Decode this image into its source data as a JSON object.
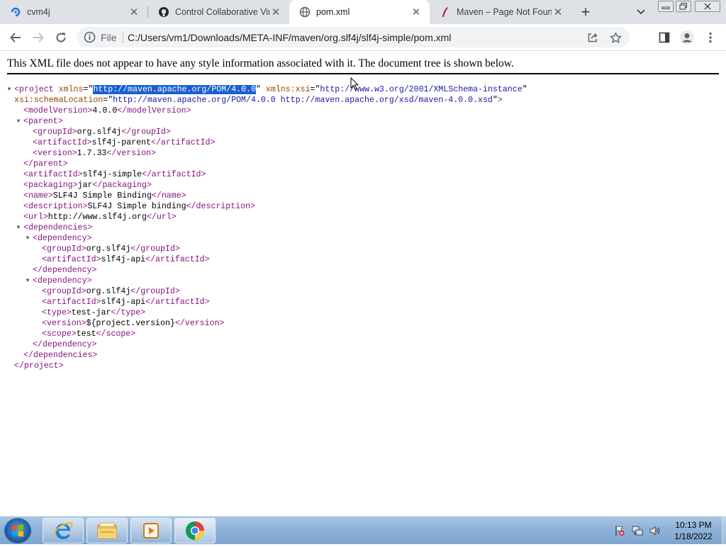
{
  "browser": {
    "tabs": [
      {
        "title": "cvm4j",
        "icon": "cvm4j-favicon-icon",
        "active": false
      },
      {
        "title": "Control Collaborative Vir",
        "icon": "github-favicon-icon",
        "active": false
      },
      {
        "title": "pom.xml",
        "icon": "globe-favicon-icon",
        "active": true
      },
      {
        "title": "Maven – Page Not Found",
        "icon": "maven-feather-icon",
        "active": false
      }
    ],
    "scheme_label": "File",
    "url": "C:/Users/vm1/Downloads/META-INF/maven/org.slf4j/slf4j-simple/pom.xml"
  },
  "page": {
    "notice": "This XML file does not appear to have any style information associated with it. The document tree is shown below.",
    "xml": {
      "root_tag": "project",
      "xmlns_attr": "xmlns",
      "xmlns_value": "http://maven.apache.org/POM/4.0.0",
      "xsi_attr": "xmlns:xsi",
      "xsi_value": "http://www.w3.org/2001/XMLSchema-instance",
      "schema_attr": "xsi:schemaLocation",
      "schema_value": "http://maven.apache.org/POM/4.0.0 http://maven.apache.org/xsd/maven-4.0.0.xsd",
      "modelVersion": "4.0.0",
      "parent": {
        "groupId": "org.slf4j",
        "artifactId": "slf4j-parent",
        "version": "1.7.33"
      },
      "artifactId": "slf4j-simple",
      "packaging": "jar",
      "name": "SLF4J Simple Binding",
      "description": "SLF4J Simple binding",
      "url": "http://www.slf4j.org",
      "dependencies": [
        {
          "groupId": "org.slf4j",
          "artifactId": "slf4j-api"
        },
        {
          "groupId": "org.slf4j",
          "artifactId": "slf4j-api",
          "type": "test-jar",
          "version": "${project.version}",
          "scope": "test"
        }
      ]
    }
  },
  "taskbar": {
    "apps": [
      "internet-explorer-icon",
      "file-explorer-icon",
      "media-player-icon",
      "chrome-icon"
    ],
    "tray_icons": [
      "action-center-flag-icon",
      "network-icon",
      "volume-icon"
    ],
    "time": "10:13 PM",
    "date": "1/18/2022"
  },
  "colors": {
    "tag": "#881280",
    "attr_name": "#994500",
    "attr_value": "#1a1aa6",
    "selection": "#1a5fd0"
  }
}
